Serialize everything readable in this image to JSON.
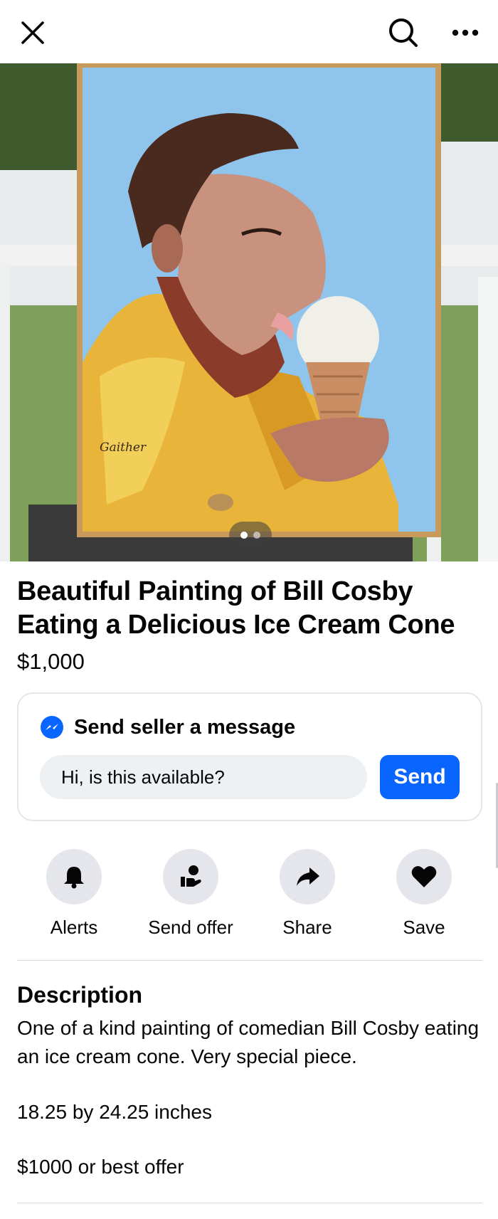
{
  "toolbar": {
    "close_icon": "close-icon",
    "search_icon": "search-icon",
    "more_icon": "more-dots-icon"
  },
  "listing": {
    "title": "Beautiful Painting of Bill Cosby Eating a Delicious Ice Cream Cone",
    "price": "$1,000",
    "photo": {
      "signature": "Gaither",
      "current_page": 1,
      "total_pages": 2
    }
  },
  "message": {
    "heading": "Send seller a message",
    "input_value": "Hi, is this available?",
    "send_label": "Send",
    "messenger_color": "#0866ff"
  },
  "actions": [
    {
      "label": "Alerts",
      "icon": "bell-icon"
    },
    {
      "label": "Send offer",
      "icon": "offer-hand-icon"
    },
    {
      "label": "Share",
      "icon": "share-arrow-icon"
    },
    {
      "label": "Save",
      "icon": "heart-icon"
    }
  ],
  "description": {
    "heading": "Description",
    "text": "One of a kind painting of comedian Bill Cosby eating an ice cream cone. Very special piece.",
    "size": "18.25 by 24.25 inches",
    "offer": "$1000 or best offer"
  },
  "colors": {
    "accent": "#0866ff",
    "chip_bg": "#e4e6eb",
    "input_bg": "#eef1f4"
  }
}
